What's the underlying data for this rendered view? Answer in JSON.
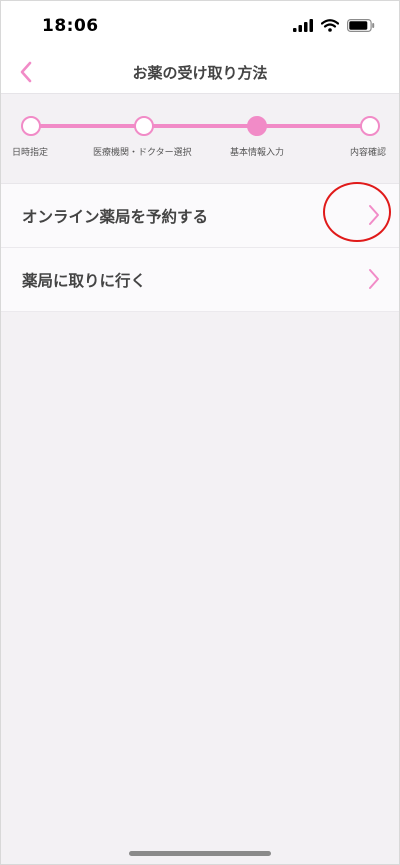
{
  "status_bar": {
    "time": "18:06",
    "icons": [
      "signal-icon",
      "wifi-icon",
      "battery-icon"
    ]
  },
  "header": {
    "title": "お薬の受け取り方法",
    "back_icon": "chevron-left-icon"
  },
  "steps": [
    {
      "label": "日時指定",
      "state": "done"
    },
    {
      "label": "医療機関・ドクター選択",
      "state": "done"
    },
    {
      "label": "基本情報入力",
      "state": "current"
    },
    {
      "label": "内容確認",
      "state": "pending"
    }
  ],
  "options": [
    {
      "label": "オンライン薬局を予約する",
      "icon": "chevron-right-icon"
    },
    {
      "label": "薬局に取りに行く",
      "icon": "chevron-right-icon"
    }
  ],
  "colors": {
    "accent": "#f18bc7",
    "highlight": "#e01a1a",
    "text": "#444444"
  }
}
